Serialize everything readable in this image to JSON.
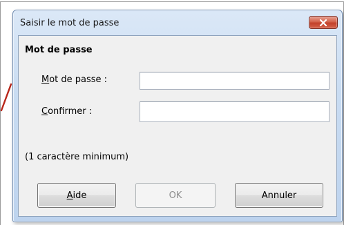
{
  "window": {
    "title": "Saisir le mot de passe"
  },
  "group": {
    "title": "Mot de passe"
  },
  "fields": {
    "password": {
      "label_accel": "M",
      "label_rest": "ot de passe :",
      "value": ""
    },
    "confirm": {
      "label_accel": "C",
      "label_rest": "onfirmer :",
      "value": ""
    }
  },
  "hint": "(1 caractère minimum)",
  "buttons": {
    "help": {
      "accel": "A",
      "rest": "ide"
    },
    "ok": {
      "label": "OK",
      "enabled": false
    },
    "cancel": {
      "label": "Annuler"
    }
  },
  "colors": {
    "title_gradient_top": "#dbe8f7",
    "close_button": "#c2412a",
    "client_background": "#f0f0f0",
    "disabled_text": "#8d8d8d"
  },
  "icons": {
    "close": "close-x-icon",
    "background_pointer": "arrow-pointer-icon"
  }
}
